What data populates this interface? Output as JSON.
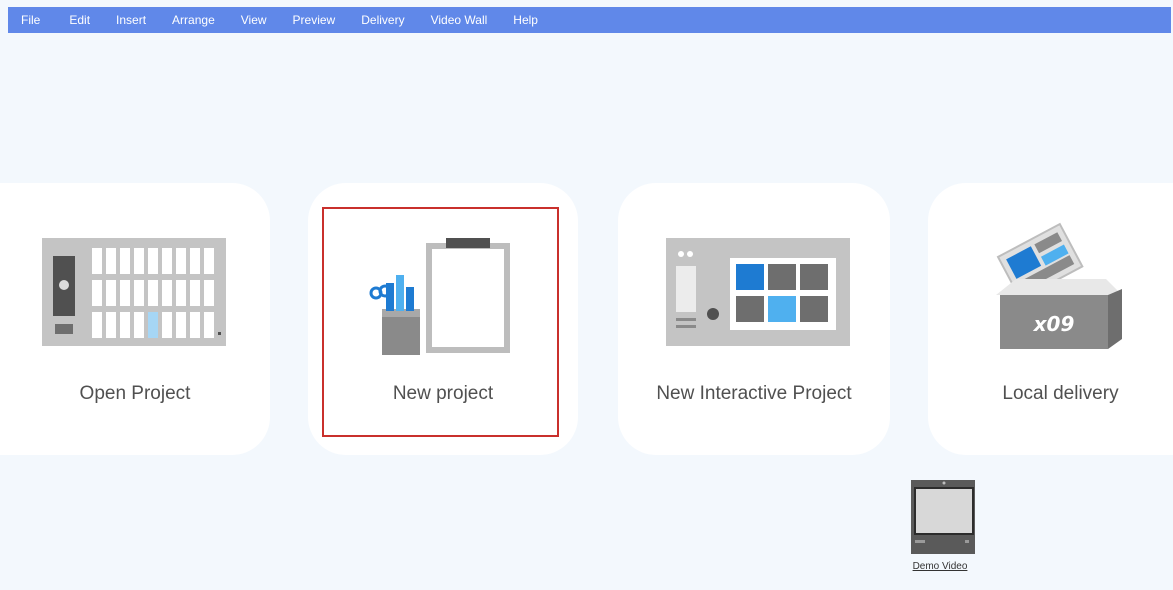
{
  "menu": [
    "File",
    "Edit",
    "Insert",
    "Arrange",
    "View",
    "Preview",
    "Delivery",
    "Video Wall",
    "Help"
  ],
  "cards": {
    "open_project": {
      "label": "Open Project",
      "icon": "grid-panel-icon"
    },
    "new_project": {
      "label": "New project",
      "icon": "clipboard-tools-icon"
    },
    "new_interactive": {
      "label": "New Interactive Project",
      "icon": "interactive-screen-icon"
    },
    "local_delivery": {
      "label": "Local delivery",
      "icon": "delivery-box-icon",
      "box_text": "x09"
    }
  },
  "demo": {
    "label": "Demo Video",
    "icon": "monitor-icon"
  },
  "colors": {
    "menubar": "#6088e9",
    "highlight": "#c9302c",
    "accent_blue": "#1e7bd2",
    "light_blue": "#4fb0ef"
  }
}
